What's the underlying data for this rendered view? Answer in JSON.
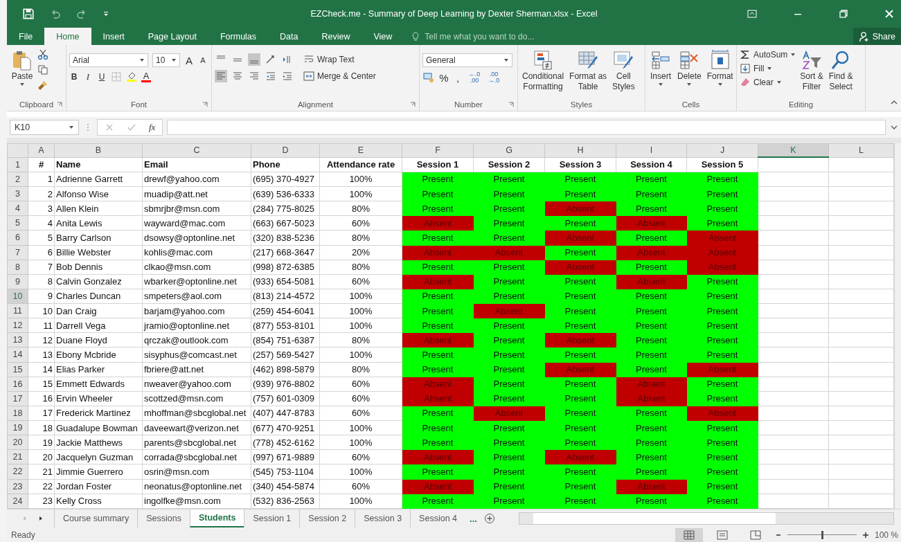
{
  "window": {
    "title": "EZCheck.me - Summary of Deep Learning by Dexter Sherman.xlsx - Excel"
  },
  "ribbon_tabs": [
    {
      "label": "File",
      "selected": false
    },
    {
      "label": "Home",
      "selected": true
    },
    {
      "label": "Insert",
      "selected": false
    },
    {
      "label": "Page Layout",
      "selected": false
    },
    {
      "label": "Formulas",
      "selected": false
    },
    {
      "label": "Data",
      "selected": false
    },
    {
      "label": "Review",
      "selected": false
    },
    {
      "label": "View",
      "selected": false
    }
  ],
  "tell_me": {
    "placeholder": "Tell me what you want to do..."
  },
  "share": "Share",
  "ribbon": {
    "clipboard": {
      "label": "Clipboard",
      "paste": "Paste"
    },
    "font": {
      "label": "Font",
      "name": "Arial",
      "size": "10",
      "bold": "B",
      "italic": "I",
      "underline": "U",
      "grow": "A",
      "shrink": "A",
      "text_color_letter": "A"
    },
    "alignment": {
      "label": "Alignment",
      "wrap_text": "Wrap Text",
      "merge_center": "Merge & Center"
    },
    "number": {
      "label": "Number",
      "format": "General",
      "percent": "%",
      "comma": ",",
      "increase": "←.0 .00",
      "decrease": ".00 →.0"
    },
    "styles": {
      "label": "Styles",
      "buttons": [
        {
          "lines": [
            "Conditional",
            "Formatting"
          ],
          "kind": "conditional"
        },
        {
          "lines": [
            "Format as",
            "Table"
          ],
          "kind": "table"
        },
        {
          "lines": [
            "Cell",
            "Styles"
          ],
          "kind": "cellstyles"
        }
      ]
    },
    "cells": {
      "label": "Cells",
      "buttons": [
        {
          "label": "Insert",
          "kind": "insert"
        },
        {
          "label": "Delete",
          "kind": "delete"
        },
        {
          "label": "Format",
          "kind": "format"
        }
      ]
    },
    "editing": {
      "label": "Editing",
      "autosum": "AutoSum",
      "fill": "Fill",
      "clear": "Clear",
      "sort": [
        "Sort &",
        "Filter"
      ],
      "find": [
        "Find &",
        "Select"
      ]
    }
  },
  "formula_bar": {
    "name_box": "K10",
    "fx": "fx"
  },
  "columns": [
    {
      "letter": "A",
      "selected": false
    },
    {
      "letter": "B",
      "selected": false
    },
    {
      "letter": "C",
      "selected": false
    },
    {
      "letter": "D",
      "selected": false
    },
    {
      "letter": "E",
      "selected": false
    },
    {
      "letter": "F",
      "selected": false
    },
    {
      "letter": "G",
      "selected": false
    },
    {
      "letter": "H",
      "selected": false
    },
    {
      "letter": "I",
      "selected": false
    },
    {
      "letter": "J",
      "selected": false
    },
    {
      "letter": "K",
      "selected": true
    },
    {
      "letter": "L",
      "selected": false
    }
  ],
  "header": {
    "row": "1",
    "cells": [
      "#",
      "Name",
      "Email",
      "Phone",
      "Attendance rate",
      "Session 1",
      "Session 2",
      "Session 3",
      "Session 4",
      "Session 5"
    ]
  },
  "rows": [
    {
      "row": "2",
      "selected": false,
      "num": "1",
      "name": "Adrienne Garrett",
      "email": "drewf@yahoo.com",
      "phone": "(695) 370-4927",
      "rate": "100%",
      "sessions": [
        {
          "text": "Present",
          "absent": false
        },
        {
          "text": "Present",
          "absent": false
        },
        {
          "text": "Present",
          "absent": false
        },
        {
          "text": "Present",
          "absent": false
        },
        {
          "text": "Present",
          "absent": false
        }
      ]
    },
    {
      "row": "3",
      "selected": false,
      "num": "2",
      "name": "Alfonso Wise",
      "email": "muadip@att.net",
      "phone": "(639) 536-6333",
      "rate": "100%",
      "sessions": [
        {
          "text": "Present",
          "absent": false
        },
        {
          "text": "Present",
          "absent": false
        },
        {
          "text": "Present",
          "absent": false
        },
        {
          "text": "Present",
          "absent": false
        },
        {
          "text": "Present",
          "absent": false
        }
      ]
    },
    {
      "row": "4",
      "selected": false,
      "num": "3",
      "name": "Allen Klein",
      "email": "sbmrjbr@msn.com",
      "phone": "(284) 775-8025",
      "rate": "80%",
      "sessions": [
        {
          "text": "Present",
          "absent": false
        },
        {
          "text": "Present",
          "absent": false
        },
        {
          "text": "Absent",
          "absent": true
        },
        {
          "text": "Present",
          "absent": false
        },
        {
          "text": "Present",
          "absent": false
        }
      ]
    },
    {
      "row": "5",
      "selected": false,
      "num": "4",
      "name": "Anita Lewis",
      "email": "wayward@mac.com",
      "phone": "(663) 667-5023",
      "rate": "60%",
      "sessions": [
        {
          "text": "Absent",
          "absent": true
        },
        {
          "text": "Present",
          "absent": false
        },
        {
          "text": "Present",
          "absent": false
        },
        {
          "text": "Absent",
          "absent": true
        },
        {
          "text": "Present",
          "absent": false
        }
      ]
    },
    {
      "row": "6",
      "selected": false,
      "num": "5",
      "name": "Barry Carlson",
      "email": "dsowsy@optonline.net",
      "phone": "(320) 838-5236",
      "rate": "80%",
      "sessions": [
        {
          "text": "Present",
          "absent": false
        },
        {
          "text": "Present",
          "absent": false
        },
        {
          "text": "Absent",
          "absent": true
        },
        {
          "text": "Present",
          "absent": false
        },
        {
          "text": "Absent",
          "absent": true
        }
      ]
    },
    {
      "row": "7",
      "selected": false,
      "num": "6",
      "name": "Billie Webster",
      "email": "kohlis@mac.com",
      "phone": "(217) 668-3647",
      "rate": "20%",
      "sessions": [
        {
          "text": "Absent",
          "absent": true
        },
        {
          "text": "Absent",
          "absent": true
        },
        {
          "text": "Present",
          "absent": false
        },
        {
          "text": "Absent",
          "absent": true
        },
        {
          "text": "Absent",
          "absent": true
        }
      ]
    },
    {
      "row": "8",
      "selected": false,
      "num": "7",
      "name": "Bob Dennis",
      "email": "clkao@msn.com",
      "phone": "(998) 872-6385",
      "rate": "80%",
      "sessions": [
        {
          "text": "Present",
          "absent": false
        },
        {
          "text": "Present",
          "absent": false
        },
        {
          "text": "Absent",
          "absent": true
        },
        {
          "text": "Present",
          "absent": false
        },
        {
          "text": "Absent",
          "absent": true
        }
      ]
    },
    {
      "row": "9",
      "selected": false,
      "num": "8",
      "name": "Calvin Gonzalez",
      "email": "wbarker@optonline.net",
      "phone": "(933) 654-5081",
      "rate": "60%",
      "sessions": [
        {
          "text": "Absent",
          "absent": true
        },
        {
          "text": "Present",
          "absent": false
        },
        {
          "text": "Present",
          "absent": false
        },
        {
          "text": "Absent",
          "absent": true
        },
        {
          "text": "Present",
          "absent": false
        }
      ]
    },
    {
      "row": "10",
      "selected": true,
      "num": "9",
      "name": "Charles Duncan",
      "email": "smpeters@aol.com",
      "phone": "(813) 214-4572",
      "rate": "100%",
      "sessions": [
        {
          "text": "Present",
          "absent": false
        },
        {
          "text": "Present",
          "absent": false
        },
        {
          "text": "Present",
          "absent": false
        },
        {
          "text": "Present",
          "absent": false
        },
        {
          "text": "Present",
          "absent": false
        }
      ]
    },
    {
      "row": "11",
      "selected": false,
      "num": "10",
      "name": "Dan Craig",
      "email": "barjam@yahoo.com",
      "phone": "(259) 454-6041",
      "rate": "100%",
      "sessions": [
        {
          "text": "Present",
          "absent": false
        },
        {
          "text": "Absent",
          "absent": true
        },
        {
          "text": "Present",
          "absent": false
        },
        {
          "text": "Present",
          "absent": false
        },
        {
          "text": "Present",
          "absent": false
        }
      ]
    },
    {
      "row": "12",
      "selected": false,
      "num": "11",
      "name": "Darrell Vega",
      "email": "jramio@optonline.net",
      "phone": "(877) 553-8101",
      "rate": "100%",
      "sessions": [
        {
          "text": "Present",
          "absent": false
        },
        {
          "text": "Present",
          "absent": false
        },
        {
          "text": "Present",
          "absent": false
        },
        {
          "text": "Present",
          "absent": false
        },
        {
          "text": "Present",
          "absent": false
        }
      ]
    },
    {
      "row": "13",
      "selected": false,
      "num": "12",
      "name": "Duane Floyd",
      "email": "qrczak@outlook.com",
      "phone": "(854) 751-6387",
      "rate": "80%",
      "sessions": [
        {
          "text": "Absent",
          "absent": true
        },
        {
          "text": "Present",
          "absent": false
        },
        {
          "text": "Absent",
          "absent": true
        },
        {
          "text": "Present",
          "absent": false
        },
        {
          "text": "Present",
          "absent": false
        }
      ]
    },
    {
      "row": "14",
      "selected": false,
      "num": "13",
      "name": "Ebony Mcbride",
      "email": "sisyphus@comcast.net",
      "phone": "(257) 569-5427",
      "rate": "100%",
      "sessions": [
        {
          "text": "Present",
          "absent": false
        },
        {
          "text": "Present",
          "absent": false
        },
        {
          "text": "Present",
          "absent": false
        },
        {
          "text": "Present",
          "absent": false
        },
        {
          "text": "Present",
          "absent": false
        }
      ]
    },
    {
      "row": "15",
      "selected": false,
      "num": "14",
      "name": "Elias Parker",
      "email": "fbriere@att.net",
      "phone": "(462) 898-5879",
      "rate": "80%",
      "sessions": [
        {
          "text": "Present",
          "absent": false
        },
        {
          "text": "Present",
          "absent": false
        },
        {
          "text": "Absent",
          "absent": true
        },
        {
          "text": "Present",
          "absent": false
        },
        {
          "text": "Absent",
          "absent": true
        }
      ]
    },
    {
      "row": "16",
      "selected": false,
      "num": "15",
      "name": "Emmett Edwards",
      "email": "nweaver@yahoo.com",
      "phone": "(939) 976-8802",
      "rate": "60%",
      "sessions": [
        {
          "text": "Absent",
          "absent": true
        },
        {
          "text": "Present",
          "absent": false
        },
        {
          "text": "Present",
          "absent": false
        },
        {
          "text": "Absent",
          "absent": true
        },
        {
          "text": "Present",
          "absent": false
        }
      ]
    },
    {
      "row": "17",
      "selected": false,
      "num": "16",
      "name": "Ervin Wheeler",
      "email": "scottzed@msn.com",
      "phone": "(757) 601-0309",
      "rate": "60%",
      "sessions": [
        {
          "text": "Absent",
          "absent": true
        },
        {
          "text": "Present",
          "absent": false
        },
        {
          "text": "Present",
          "absent": false
        },
        {
          "text": "Absent",
          "absent": true
        },
        {
          "text": "Present",
          "absent": false
        }
      ]
    },
    {
      "row": "18",
      "selected": false,
      "num": "17",
      "name": "Frederick Martinez",
      "email": "mhoffman@sbcglobal.net",
      "phone": "(407) 447-8783",
      "rate": "60%",
      "sessions": [
        {
          "text": "Present",
          "absent": false
        },
        {
          "text": "Absent",
          "absent": true
        },
        {
          "text": "Present",
          "absent": false
        },
        {
          "text": "Present",
          "absent": false
        },
        {
          "text": "Absent",
          "absent": true
        }
      ]
    },
    {
      "row": "19",
      "selected": false,
      "num": "18",
      "name": "Guadalupe Bowman",
      "email": "daveewart@verizon.net",
      "phone": "(677) 470-9251",
      "rate": "100%",
      "sessions": [
        {
          "text": "Present",
          "absent": false
        },
        {
          "text": "Present",
          "absent": false
        },
        {
          "text": "Present",
          "absent": false
        },
        {
          "text": "Present",
          "absent": false
        },
        {
          "text": "Present",
          "absent": false
        }
      ]
    },
    {
      "row": "20",
      "selected": false,
      "num": "19",
      "name": "Jackie Matthews",
      "email": "parents@sbcglobal.net",
      "phone": "(778) 452-6162",
      "rate": "100%",
      "sessions": [
        {
          "text": "Present",
          "absent": false
        },
        {
          "text": "Present",
          "absent": false
        },
        {
          "text": "Present",
          "absent": false
        },
        {
          "text": "Present",
          "absent": false
        },
        {
          "text": "Present",
          "absent": false
        }
      ]
    },
    {
      "row": "21",
      "selected": false,
      "num": "20",
      "name": "Jacquelyn Guzman",
      "email": "corrada@sbcglobal.net",
      "phone": "(997) 671-9889",
      "rate": "60%",
      "sessions": [
        {
          "text": "Absent",
          "absent": true
        },
        {
          "text": "Present",
          "absent": false
        },
        {
          "text": "Absent",
          "absent": true
        },
        {
          "text": "Present",
          "absent": false
        },
        {
          "text": "Present",
          "absent": false
        }
      ]
    },
    {
      "row": "22",
      "selected": false,
      "num": "21",
      "name": "Jimmie Guerrero",
      "email": "osrin@msn.com",
      "phone": "(545) 753-1104",
      "rate": "100%",
      "sessions": [
        {
          "text": "Present",
          "absent": false
        },
        {
          "text": "Present",
          "absent": false
        },
        {
          "text": "Present",
          "absent": false
        },
        {
          "text": "Present",
          "absent": false
        },
        {
          "text": "Present",
          "absent": false
        }
      ]
    },
    {
      "row": "23",
      "selected": false,
      "num": "22",
      "name": "Jordan Foster",
      "email": "neonatus@optonline.net",
      "phone": "(340) 454-5874",
      "rate": "60%",
      "sessions": [
        {
          "text": "Absent",
          "absent": true
        },
        {
          "text": "Present",
          "absent": false
        },
        {
          "text": "Present",
          "absent": false
        },
        {
          "text": "Absent",
          "absent": true
        },
        {
          "text": "Present",
          "absent": false
        }
      ]
    },
    {
      "row": "24",
      "selected": false,
      "num": "23",
      "name": "Kelly Cross",
      "email": "ingolfke@msn.com",
      "phone": "(532) 836-2563",
      "rate": "100%",
      "sessions": [
        {
          "text": "Present",
          "absent": false
        },
        {
          "text": "Present",
          "absent": false
        },
        {
          "text": "Present",
          "absent": false
        },
        {
          "text": "Present",
          "absent": false
        },
        {
          "text": "Present",
          "absent": false
        }
      ]
    }
  ],
  "sheet_tabs": [
    {
      "label": "Course summary",
      "selected": false
    },
    {
      "label": "Sessions",
      "selected": false
    },
    {
      "label": "Students",
      "selected": true
    },
    {
      "label": "Session 1",
      "selected": false
    },
    {
      "label": "Session 2",
      "selected": false
    },
    {
      "label": "Session 3",
      "selected": false
    },
    {
      "label": "Session 4",
      "selected": false
    }
  ],
  "more_sheets": "...",
  "status_bar": {
    "status": "Ready",
    "zoom": "100 %",
    "zoom_slider": {
      "level": 0.5
    }
  }
}
